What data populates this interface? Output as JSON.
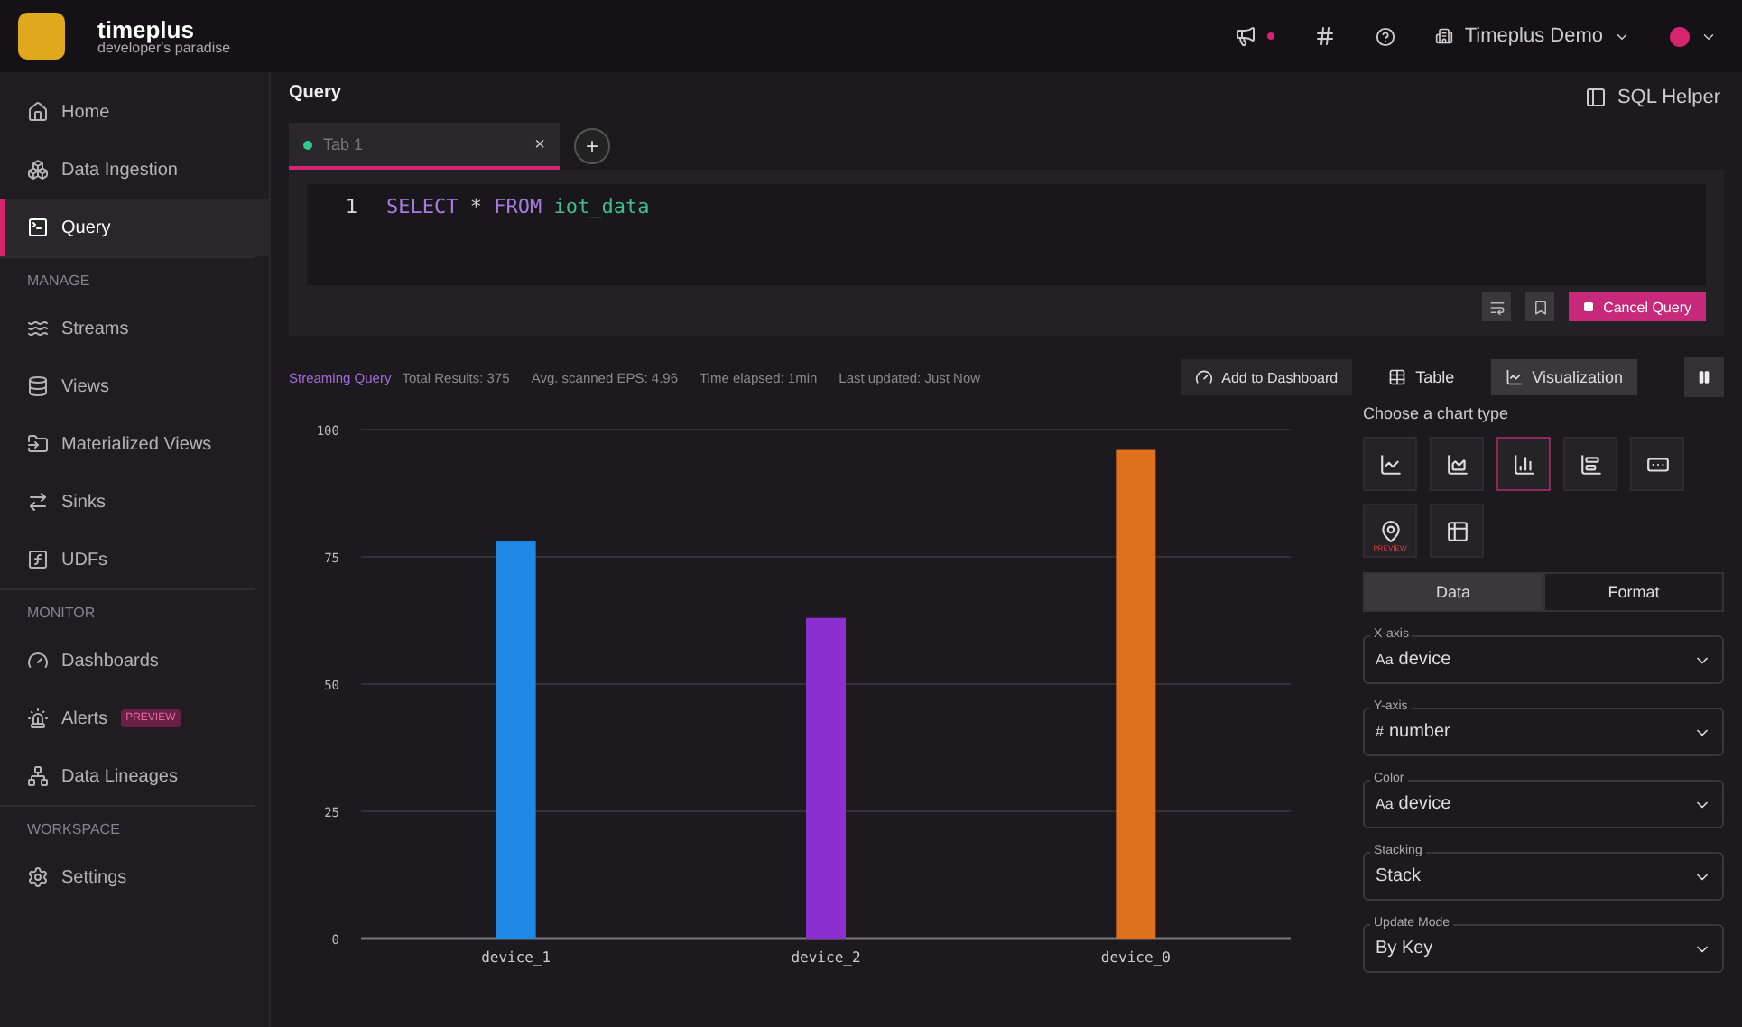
{
  "brand": {
    "name": "timeplus",
    "tagline": "developer's paradise"
  },
  "topbar": {
    "workspace": "Timeplus Demo",
    "notification": true
  },
  "sidebar": {
    "items": [
      {
        "kind": "item",
        "label": "Home",
        "selected": false
      },
      {
        "kind": "item",
        "label": "Data Ingestion",
        "selected": false
      },
      {
        "kind": "item",
        "label": "Query",
        "selected": true
      },
      {
        "kind": "section",
        "label": "MANAGE"
      },
      {
        "kind": "item",
        "label": "Streams",
        "selected": false
      },
      {
        "kind": "item",
        "label": "Views",
        "selected": false
      },
      {
        "kind": "item",
        "label": "Materialized Views",
        "selected": false
      },
      {
        "kind": "item",
        "label": "Sinks",
        "selected": false
      },
      {
        "kind": "item",
        "label": "UDFs",
        "selected": false
      },
      {
        "kind": "section",
        "label": "MONITOR"
      },
      {
        "kind": "item",
        "label": "Dashboards",
        "selected": false
      },
      {
        "kind": "item",
        "label": "Alerts",
        "badge": "PREVIEW",
        "selected": false
      },
      {
        "kind": "item",
        "label": "Data Lineages",
        "selected": false
      },
      {
        "kind": "section",
        "label": "WORKSPACE"
      },
      {
        "kind": "item",
        "label": "Settings",
        "selected": false
      }
    ]
  },
  "page_title": "Query",
  "sql_helper": "SQL Helper",
  "tabs": [
    {
      "label": "Tab 1",
      "selected": true,
      "color": "#2ecc8f",
      "close": "×"
    }
  ],
  "add_tab": "+",
  "editor": {
    "line_number": "1",
    "tokens": [
      {
        "text": "SELECT",
        "kind": "keyword"
      },
      {
        "text": "*",
        "kind": "operator"
      },
      {
        "text": "FROM",
        "kind": "keyword"
      },
      {
        "text": "iot_data",
        "kind": "identifier"
      }
    ]
  },
  "cancel_button": "Cancel Query",
  "stats": {
    "mode": "Streaming Query",
    "items": [
      "Total Results: 375",
      "Avg. scanned EPS: 4.96",
      "Time elapsed: 1min",
      "Last updated: Just Now"
    ]
  },
  "add_to_dashboard": "Add to Dashboard",
  "view_tabs": [
    {
      "kind": "table",
      "label": "Table",
      "selected": false
    },
    {
      "kind": "chart",
      "label": "Visualization",
      "selected": true
    }
  ],
  "chart": {
    "chart_data": {
      "type": "bar",
      "categories": [
        "device_1",
        "device_2",
        "device_0"
      ],
      "grid": true,
      "series": [
        {
          "color": "#1e88e5",
          "values": [
            78,
            null,
            null
          ]
        },
        {
          "color": "#8b2fd0",
          "values": [
            null,
            63,
            null
          ]
        },
        {
          "color": "#e0711c",
          "values": [
            null,
            null,
            96
          ]
        }
      ],
      "ylim": [
        0,
        100
      ],
      "yticks": [
        0,
        25,
        50,
        75,
        100
      ]
    }
  },
  "chart_panel": {
    "title": "Choose a chart type",
    "types": [
      {
        "kind": "line",
        "selected": false
      },
      {
        "kind": "area",
        "selected": false
      },
      {
        "kind": "bar",
        "selected": true
      },
      {
        "kind": "hbar",
        "selected": false
      },
      {
        "kind": "number",
        "selected": false
      },
      {
        "kind": "map",
        "selected": false,
        "badge": "PREVIEW"
      },
      {
        "kind": "table",
        "selected": false
      }
    ],
    "tabs": [
      {
        "label": "Data",
        "selected": true
      },
      {
        "label": "Format",
        "selected": false
      }
    ],
    "fields": [
      {
        "label": "X-axis",
        "prefix": "Aa",
        "value": "device"
      },
      {
        "label": "Y-axis",
        "prefix": "#",
        "value": "number"
      },
      {
        "label": "Color",
        "prefix": "Aa",
        "value": "device"
      },
      {
        "label": "Stacking",
        "value": "Stack"
      },
      {
        "label": "Update Mode",
        "value": "By Key"
      }
    ]
  }
}
